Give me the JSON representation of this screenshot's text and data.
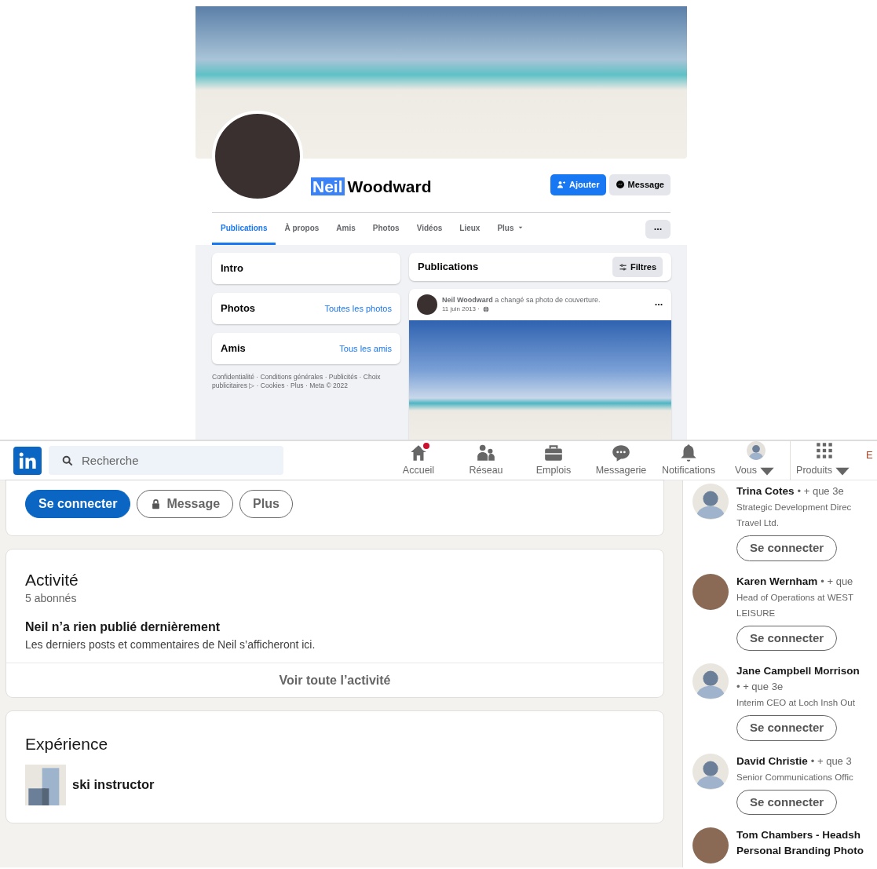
{
  "facebook": {
    "profile_name": {
      "first": "Neil",
      "first_highlighted": true,
      "last": "Woodward"
    },
    "actions": [
      {
        "label": "Ajouter",
        "kind": "primary"
      },
      {
        "label": "Message",
        "kind": "secondary"
      }
    ],
    "tabs": [
      {
        "label": "Publications",
        "selected": true,
        "dropdown": false
      },
      {
        "label": "À propos",
        "selected": false,
        "dropdown": false
      },
      {
        "label": "Amis",
        "selected": false,
        "dropdown": false
      },
      {
        "label": "Photos",
        "selected": false,
        "dropdown": false
      },
      {
        "label": "Vidéos",
        "selected": false,
        "dropdown": false
      },
      {
        "label": "Lieux",
        "selected": false,
        "dropdown": false
      },
      {
        "label": "Plus",
        "selected": false,
        "dropdown": true
      }
    ],
    "sidebar_cards": [
      {
        "title": "Intro"
      },
      {
        "title": "Photos",
        "link": "Toutes les photos"
      },
      {
        "title": "Amis",
        "link": "Tous les amis"
      }
    ],
    "footer": "Confidentialité · Conditions générales · Publicités · Choix publicitaires ▷ · Cookies · Plus · Meta © 2022",
    "feed": {
      "title": "Publications",
      "filter_button": "Filtres",
      "post": {
        "headline": "**Neil Woodward** a changé sa photo de couverture.",
        "date": "11 juin 2013 ·"
      }
    }
  },
  "linkedin": {
    "search": {
      "placeholder": "Recherche"
    },
    "nav": [
      {
        "label": "Accueil",
        "notification_dot": true,
        "dropdown": false
      },
      {
        "label": "Réseau",
        "notification_dot": false,
        "dropdown": false
      },
      {
        "label": "Emplois",
        "notification_dot": false,
        "dropdown": false
      },
      {
        "label": "Messagerie",
        "notification_dot": false,
        "dropdown": false
      },
      {
        "label": "Notifications",
        "notification_dot": false,
        "dropdown": false
      },
      {
        "label": "Vous",
        "notification_dot": false,
        "dropdown": true
      },
      {
        "label": "Produits",
        "notification_dot": false,
        "dropdown": true
      }
    ],
    "nav_cut_text": "E",
    "profile_actions": [
      {
        "label": "Se connecter",
        "kind": "primary"
      },
      {
        "label": "Message",
        "kind": "locked"
      },
      {
        "label": "Plus",
        "kind": "outline"
      }
    ],
    "activity": {
      "title": "Activité",
      "followers": "5 abonnés",
      "empty_title": "Neil n’a rien publié dernièrement",
      "empty_text": "Les derniers posts et commentaires de Neil s’afficheront ici.",
      "see_all": "Voir toute l’activité"
    },
    "experience": {
      "title": "Expérience",
      "items": [
        {
          "role": "ski instructor"
        }
      ]
    },
    "suggestions": [
      {
        "name_lines": [
          "Trina Cotes"
        ],
        "degree": "• + que 3e",
        "degree_wraps": false,
        "kind": "silhouette",
        "title_lines": [
          "Strategic Development Direc",
          "Travel Ltd."
        ],
        "button": "Se connecter"
      },
      {
        "name_lines": [
          "Karen Wernham"
        ],
        "degree": "• + que",
        "degree_wraps": false,
        "kind": "photo",
        "title_lines": [
          "Head of Operations at WEST",
          "LEISURE"
        ],
        "button": "Se connecter"
      },
      {
        "name_lines": [
          "Jane Campbell Morrison"
        ],
        "degree": "• + que 3e",
        "degree_wraps": true,
        "kind": "silhouette",
        "title_lines": [
          "Interim CEO at Loch Insh Out"
        ],
        "button": "Se connecter"
      },
      {
        "name_lines": [
          "David Christie"
        ],
        "degree": "• + que 3",
        "degree_wraps": false,
        "kind": "silhouette",
        "title_lines": [
          "Senior Communications Offic"
        ],
        "button": "Se connecter"
      },
      {
        "name_lines": [
          "Tom Chambers - Headsh",
          "Personal Branding Photo"
        ],
        "kind": "photo"
      }
    ]
  }
}
